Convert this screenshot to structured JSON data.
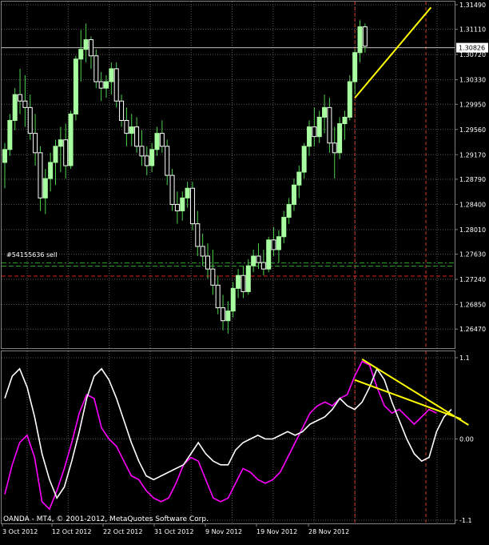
{
  "colors": {
    "background": "#000000",
    "grid": "#5a5a5a",
    "bull_candle": "#a8ffa0",
    "bear_candle": "#ffffff",
    "wick": "#4fd04f",
    "trendline": "#ffff00",
    "current_price_line": "#c0c0c0",
    "order_line": "#2ea02e",
    "stop_line": "#e02020",
    "vline": "#d03c2a",
    "osc_main": "#ff00ff",
    "osc_signal": "#ffffff",
    "price_box_bg": "#ffffff",
    "price_box_text": "#000000",
    "text": "#ffffff"
  },
  "chart_data": [
    {
      "type": "candlestick",
      "symbol_pair": "EURUSD",
      "ylim": [
        1.262,
        1.3149
      ],
      "y_ticks": [
        "1.31490",
        "1.31110",
        "1.30720",
        "1.30330",
        "1.29950",
        "1.29560",
        "1.29170",
        "1.28790",
        "1.28400",
        "1.28010",
        "1.27630",
        "1.27240",
        "1.26850",
        "1.26470"
      ],
      "current_price": "1.30826",
      "order_label": "#54155636 sell",
      "order_price": 1.2747,
      "stop_price": 1.2729,
      "vertical_lines_index": [
        69,
        83
      ],
      "trendline": {
        "from": [
          69,
          1.3005
        ],
        "to": [
          84,
          1.3145
        ]
      },
      "candles": [
        [
          1.2905,
          1.2935,
          1.2865,
          1.2925
        ],
        [
          1.2925,
          1.298,
          1.2915,
          1.297
        ],
        [
          1.297,
          1.302,
          1.2955,
          1.301
        ],
        [
          1.301,
          1.305,
          1.298,
          1.3
        ],
        [
          1.3,
          1.304,
          1.296,
          1.299
        ],
        [
          1.299,
          1.301,
          1.294,
          1.295
        ],
        [
          1.295,
          1.298,
          1.29,
          1.292
        ],
        [
          1.292,
          1.293,
          1.283,
          1.285
        ],
        [
          1.285,
          1.2895,
          1.2825,
          1.288
        ],
        [
          1.288,
          1.292,
          1.286,
          1.2905
        ],
        [
          1.2905,
          1.294,
          1.287,
          1.293
        ],
        [
          1.293,
          1.296,
          1.289,
          1.294
        ],
        [
          1.294,
          1.2965,
          1.288,
          1.29
        ],
        [
          1.29,
          1.2985,
          1.2895,
          1.298
        ],
        [
          1.298,
          1.307,
          1.297,
          1.3065
        ],
        [
          1.3065,
          1.311,
          1.303,
          1.308
        ],
        [
          1.308,
          1.312,
          1.306,
          1.3095
        ],
        [
          1.3095,
          1.31,
          1.305,
          1.307
        ],
        [
          1.307,
          1.308,
          1.302,
          1.303
        ],
        [
          1.303,
          1.3045,
          1.3,
          1.302
        ],
        [
          1.302,
          1.304,
          1.3005,
          1.303
        ],
        [
          1.303,
          1.306,
          1.301,
          1.305
        ],
        [
          1.305,
          1.306,
          1.299,
          1.3
        ],
        [
          1.3,
          1.301,
          1.296,
          1.297
        ],
        [
          1.297,
          1.299,
          1.293,
          1.295
        ],
        [
          1.295,
          1.298,
          1.293,
          1.296
        ],
        [
          1.296,
          1.2975,
          1.292,
          1.293
        ],
        [
          1.293,
          1.2955,
          1.29,
          1.2915
        ],
        [
          1.2915,
          1.293,
          1.2885,
          1.29
        ],
        [
          1.29,
          1.2935,
          1.289,
          1.2925
        ],
        [
          1.2925,
          1.296,
          1.2915,
          1.295
        ],
        [
          1.295,
          1.297,
          1.292,
          1.293
        ],
        [
          1.293,
          1.294,
          1.287,
          1.2885
        ],
        [
          1.2885,
          1.2895,
          1.283,
          1.284
        ],
        [
          1.284,
          1.286,
          1.281,
          1.283
        ],
        [
          1.283,
          1.286,
          1.2815,
          1.285
        ],
        [
          1.285,
          1.2875,
          1.2835,
          1.2865
        ],
        [
          1.2865,
          1.2875,
          1.28,
          1.281
        ],
        [
          1.281,
          1.283,
          1.276,
          1.2775
        ],
        [
          1.2775,
          1.2795,
          1.2745,
          1.276
        ],
        [
          1.276,
          1.278,
          1.2725,
          1.274
        ],
        [
          1.274,
          1.277,
          1.27,
          1.2715
        ],
        [
          1.2715,
          1.273,
          1.267,
          1.268
        ],
        [
          1.268,
          1.27,
          1.2645,
          1.266
        ],
        [
          1.266,
          1.269,
          1.264,
          1.2675
        ],
        [
          1.2675,
          1.272,
          1.2665,
          1.271
        ],
        [
          1.271,
          1.274,
          1.2695,
          1.273
        ],
        [
          1.273,
          1.2745,
          1.2695,
          1.2705
        ],
        [
          1.2705,
          1.2755,
          1.27,
          1.2745
        ],
        [
          1.2745,
          1.277,
          1.2735,
          1.276
        ],
        [
          1.276,
          1.278,
          1.274,
          1.275
        ],
        [
          1.275,
          1.277,
          1.273,
          1.274
        ],
        [
          1.274,
          1.279,
          1.2735,
          1.2785
        ],
        [
          1.2785,
          1.2805,
          1.276,
          1.277
        ],
        [
          1.277,
          1.28,
          1.275,
          1.279
        ],
        [
          1.279,
          1.283,
          1.278,
          1.282
        ],
        [
          1.282,
          1.285,
          1.281,
          1.284
        ],
        [
          1.284,
          1.288,
          1.283,
          1.287
        ],
        [
          1.287,
          1.29,
          1.285,
          1.289
        ],
        [
          1.289,
          1.2935,
          1.288,
          1.293
        ],
        [
          1.293,
          1.297,
          1.2915,
          1.296
        ],
        [
          1.296,
          1.299,
          1.293,
          1.2945
        ],
        [
          1.2945,
          1.2985,
          1.2935,
          1.2975
        ],
        [
          1.2975,
          1.301,
          1.295,
          1.299
        ],
        [
          1.299,
          1.3005,
          1.292,
          1.2935
        ],
        [
          1.2935,
          1.296,
          1.288,
          1.292
        ],
        [
          1.292,
          1.2975,
          1.291,
          1.2965
        ],
        [
          1.2965,
          1.2985,
          1.294,
          1.2975
        ],
        [
          1.2975,
          1.304,
          1.297,
          1.303
        ],
        [
          1.303,
          1.308,
          1.301,
          1.3075
        ],
        [
          1.3075,
          1.3125,
          1.306,
          1.3115
        ],
        [
          1.3115,
          1.312,
          1.3075,
          1.3085
        ]
      ]
    },
    {
      "type": "line",
      "ylim": [
        -1.1,
        1.1
      ],
      "y_ticks": [
        "1.1",
        "0.00",
        "-1.1"
      ],
      "series": [
        {
          "name": "",
          "color_key": "osc_main",
          "values": [
            -0.75,
            -0.35,
            -0.05,
            0.05,
            -0.25,
            -0.85,
            -0.95,
            -0.7,
            -0.4,
            -0.05,
            0.35,
            0.6,
            0.55,
            0.15,
            0.0,
            -0.1,
            -0.3,
            -0.5,
            -0.55,
            -0.7,
            -0.8,
            -0.85,
            -0.8,
            -0.6,
            -0.35,
            -0.25,
            -0.3,
            -0.55,
            -0.8,
            -0.85,
            -0.8,
            -0.6,
            -0.4,
            -0.45,
            -0.55,
            -0.6,
            -0.55,
            -0.45,
            -0.25,
            -0.05,
            0.15,
            0.35,
            0.45,
            0.5,
            0.45,
            0.55,
            0.6,
            0.85,
            1.05,
            1.0,
            0.7,
            0.45,
            0.35,
            0.4,
            0.3,
            0.2,
            0.3,
            0.4,
            0.35
          ]
        },
        {
          "name": "",
          "color_key": "osc_signal",
          "values": [
            0.55,
            0.85,
            0.95,
            0.7,
            0.3,
            -0.2,
            -0.55,
            -0.8,
            -0.65,
            -0.3,
            0.1,
            0.55,
            0.85,
            0.95,
            0.8,
            0.55,
            0.25,
            -0.05,
            -0.3,
            -0.5,
            -0.55,
            -0.5,
            -0.45,
            -0.4,
            -0.35,
            -0.2,
            -0.05,
            -0.2,
            -0.3,
            -0.35,
            -0.35,
            -0.15,
            -0.05,
            0.0,
            0.05,
            0.0,
            0.0,
            0.05,
            0.1,
            0.05,
            0.1,
            0.2,
            0.25,
            0.3,
            0.4,
            0.55,
            0.45,
            0.4,
            0.5,
            0.7,
            0.95,
            0.8,
            0.5,
            0.25,
            0.0,
            -0.2,
            -0.3,
            -0.25,
            0.1,
            0.3,
            0.4
          ]
        }
      ],
      "trendlines": [
        {
          "from": [
            48,
            1.08
          ],
          "to": [
            58,
            0.32
          ]
        },
        {
          "from": [
            47,
            0.8
          ],
          "to": [
            57,
            0.4
          ]
        }
      ]
    }
  ],
  "x_axis": {
    "labels": [
      "3 Oct 2012",
      "12 Oct 2012",
      "22 Oct 2012",
      "31 Oct 2012",
      "9 Nov 2012",
      "19 Nov 2012",
      "28 Nov 2012"
    ]
  },
  "watermark": "OANDA - MT4, © 2001-2012, MetaQuotes Software Corp."
}
